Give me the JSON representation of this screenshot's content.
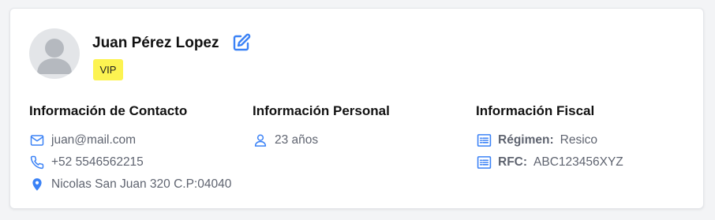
{
  "profile": {
    "name": "Juan Pérez Lopez",
    "badge": "VIP"
  },
  "contact": {
    "title": "Información de Contacto",
    "email": "juan@mail.com",
    "phone": "+52 5546562215",
    "address": "Nicolas San Juan 320 C.P:04040"
  },
  "personal": {
    "title": "Información Personal",
    "age": "23 años"
  },
  "fiscal": {
    "title": "Información Fiscal",
    "regimen_label": "Régimen:",
    "regimen_value": "Resico",
    "rfc_label": "RFC:",
    "rfc_value": "ABC123456XYZ"
  },
  "icons": [
    "user-avatar-icon",
    "edit-icon",
    "mail-icon",
    "phone-icon",
    "map-pin-icon",
    "user-icon",
    "document-list-icon"
  ],
  "colors": {
    "accent": "#3b82f6",
    "badge_bg": "#fcf351",
    "text_muted": "#5f6470",
    "avatar_bg": "#e3e5e8"
  }
}
